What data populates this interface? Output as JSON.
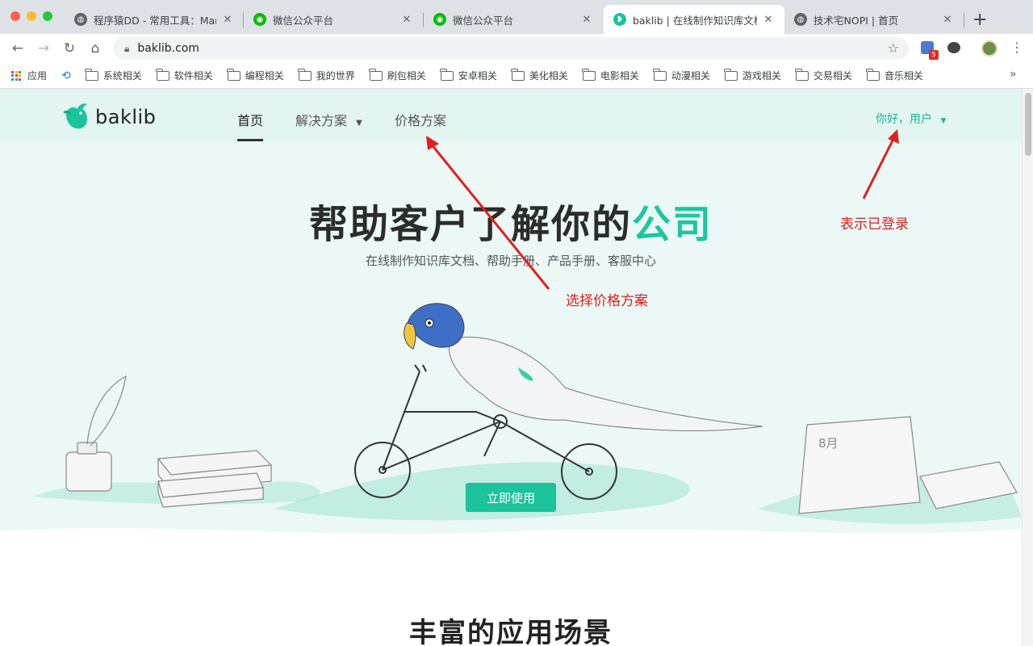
{
  "browser": {
    "tabs": [
      {
        "title": "程序猿DD - 常用工具：Markd",
        "icon": "globe-icon"
      },
      {
        "title": "微信公众平台",
        "icon": "wechat-icon"
      },
      {
        "title": "微信公众平台",
        "icon": "wechat-icon"
      },
      {
        "title": "baklib | 在线制作知识库文档",
        "icon": "baklib-bird-icon",
        "active": true
      },
      {
        "title": "技术宅NOPI | 首页",
        "icon": "globe-icon"
      }
    ],
    "url": "baklib.com",
    "extension_badge": "5",
    "bookmarks": [
      {
        "label": "应用",
        "icon": "apps-grid-icon"
      },
      {
        "label": "",
        "icon": "history-icon"
      },
      {
        "label": "系统相关",
        "icon": "folder-icon"
      },
      {
        "label": "软件相关",
        "icon": "folder-icon"
      },
      {
        "label": "编程相关",
        "icon": "folder-icon"
      },
      {
        "label": "我的世界",
        "icon": "folder-icon"
      },
      {
        "label": "刷包相关",
        "icon": "folder-icon"
      },
      {
        "label": "安卓相关",
        "icon": "folder-icon"
      },
      {
        "label": "美化相关",
        "icon": "folder-icon"
      },
      {
        "label": "电影相关",
        "icon": "folder-icon"
      },
      {
        "label": "动漫相关",
        "icon": "folder-icon"
      },
      {
        "label": "游戏相关",
        "icon": "folder-icon"
      },
      {
        "label": "交易相关",
        "icon": "folder-icon"
      },
      {
        "label": "音乐相关",
        "icon": "folder-icon"
      }
    ],
    "more_bookmarks": "»"
  },
  "site": {
    "logo": "baklib",
    "nav": {
      "home": "首页",
      "solutions": "解决方案",
      "pricing": "价格方案",
      "user": "你好，用户"
    },
    "headline_main": "帮助客户了解你的",
    "headline_accent": "公司",
    "subheadline": "在线制作知识库文档、帮助手册、产品手册、客服中心",
    "cta": "立即使用",
    "section_title": "丰富的应用场景",
    "calendar_month": "8月"
  },
  "annotations": {
    "pricing_note": "选择价格方案",
    "login_note": "表示已登录"
  },
  "colors": {
    "brand": "#1cc39d",
    "annotation": "#e02020",
    "hero_bg": "#ebf8f5"
  }
}
